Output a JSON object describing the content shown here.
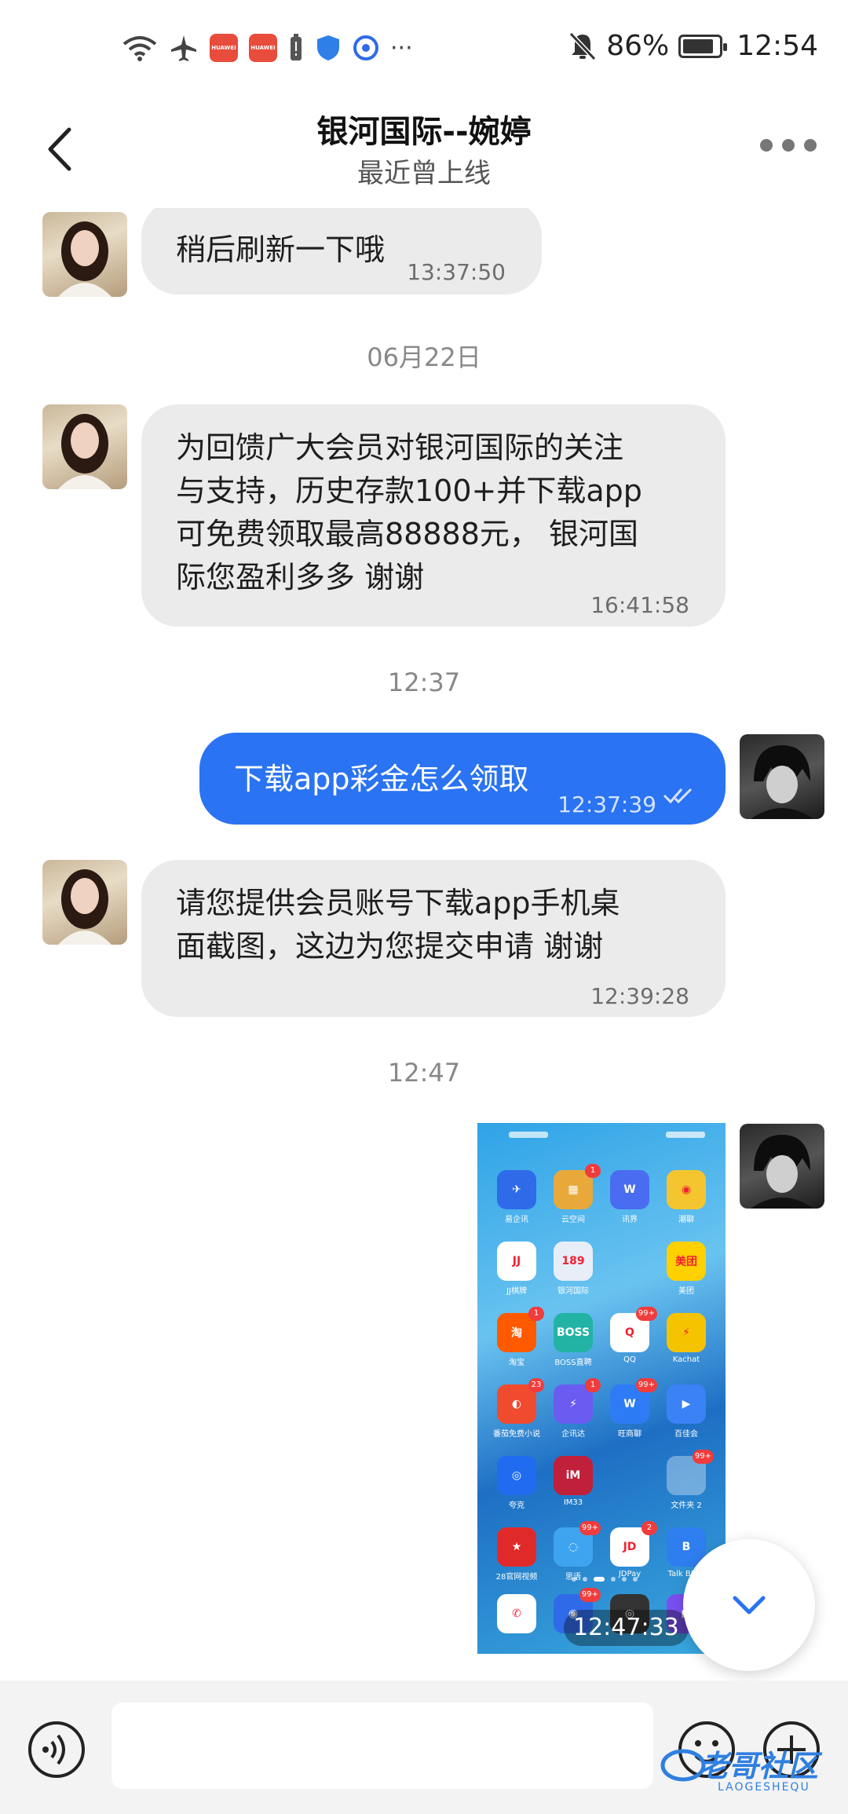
{
  "status_bar": {
    "battery_percent": "86%",
    "time": "12:54",
    "badge_label": "HUAWEI",
    "overflow": "···"
  },
  "header": {
    "title": "银河国际--婉婷",
    "subtitle": "最近曾上线"
  },
  "messages": [
    {
      "sender": "contact",
      "text": "稍后刷新一下哦",
      "time": "13:37:50"
    },
    {
      "type": "date",
      "text": "06月22日"
    },
    {
      "sender": "contact",
      "lines": [
        "为回馈广大会员对银河国际的关注",
        "与支持，历史存款100+并下载app",
        "可免费领取最高88888元， 银河国",
        "际您盈利多多 谢谢"
      ],
      "time": "16:41:58"
    },
    {
      "type": "date",
      "text": "12:37"
    },
    {
      "sender": "me",
      "text": "下载app彩金怎么领取",
      "time": "12:37:39",
      "status": "read"
    },
    {
      "sender": "contact",
      "lines": [
        "请您提供会员账号下载app手机桌",
        "面截图，这边为您提交申请 谢谢"
      ],
      "time": "12:39:28"
    },
    {
      "type": "date",
      "text": "12:47"
    },
    {
      "sender": "me",
      "type": "image",
      "time": "12:47:33"
    }
  ],
  "screenshot_apps": [
    {
      "label": "易企讯",
      "color": "#2f6be8",
      "glyph": "✈",
      "badge": ""
    },
    {
      "label": "云空间",
      "color": "#e9a93a",
      "glyph": "▦",
      "badge": "1"
    },
    {
      "label": "讯界",
      "color": "#4a6cf0",
      "glyph": "W",
      "badge": ""
    },
    {
      "label": "潮聊",
      "color": "#f5c530",
      "glyph": "◉",
      "badge": ""
    },
    {
      "label": "JJ棋牌",
      "color": "#ffffff",
      "glyph": "JJ",
      "badge": ""
    },
    {
      "label": "银河国际",
      "color": "#e8eef8",
      "glyph": "189",
      "badge": ""
    },
    {
      "label": "",
      "color": "transparent",
      "glyph": "",
      "badge": ""
    },
    {
      "label": "美团",
      "color": "#ffd100",
      "glyph": "美团",
      "badge": ""
    },
    {
      "label": "淘宝",
      "color": "#ff5a00",
      "glyph": "淘",
      "badge": "1"
    },
    {
      "label": "BOSS直聘",
      "color": "#22b3a5",
      "glyph": "BOSS",
      "badge": ""
    },
    {
      "label": "QQ",
      "color": "#ffffff",
      "glyph": "Q",
      "badge": "99+"
    },
    {
      "label": "Kachat",
      "color": "#f5c400",
      "glyph": "⚡",
      "badge": ""
    },
    {
      "label": "番茄免费小说",
      "color": "#f04b2e",
      "glyph": "◐",
      "badge": "23"
    },
    {
      "label": "企讯达",
      "color": "#6a5cf0",
      "glyph": "⚡",
      "badge": "1"
    },
    {
      "label": "旺商聊",
      "color": "#2d7cf6",
      "glyph": "W",
      "badge": "99+"
    },
    {
      "label": "百佳会",
      "color": "#3b82f6",
      "glyph": "▶",
      "badge": ""
    },
    {
      "label": "夸克",
      "color": "#1f6cf0",
      "glyph": "◎",
      "badge": ""
    },
    {
      "label": "IM33",
      "color": "#c0203a",
      "glyph": "iM",
      "badge": ""
    },
    {
      "label": "",
      "color": "transparent",
      "glyph": "",
      "badge": ""
    },
    {
      "label": "文件夹 2",
      "color": "rgba(255,255,255,0.35)",
      "glyph": "",
      "badge": "99+"
    },
    {
      "label": "28官网视频",
      "color": "#e02a2a",
      "glyph": "★",
      "badge": ""
    },
    {
      "label": "思语",
      "color": "#3fa4f0",
      "glyph": "◌",
      "badge": "99+"
    },
    {
      "label": "JDPay",
      "color": "#ffffff",
      "glyph": "JD",
      "badge": "2"
    },
    {
      "label": "Talk Blink",
      "color": "#2f7ef0",
      "glyph": "B",
      "badge": ""
    }
  ],
  "dock_apps": [
    {
      "label": "phone",
      "color": "#ffffff",
      "glyph": "✆",
      "badge": ""
    },
    {
      "label": "messages",
      "color": "#2f6be8",
      "glyph": "◉",
      "badge": "99+"
    },
    {
      "label": "camera",
      "color": "#333333",
      "glyph": "◎",
      "badge": ""
    },
    {
      "label": "video",
      "color": "#7a4ff0",
      "glyph": "▶",
      "badge": ""
    }
  ],
  "input": {
    "placeholder": ""
  },
  "watermark": {
    "text": "老哥社区",
    "sub": "LAOGESHEQU"
  },
  "colors": {
    "outgoing_bubble": "#2a73f2",
    "incoming_bubble": "#ebebeb",
    "accent": "#2a73f2"
  }
}
